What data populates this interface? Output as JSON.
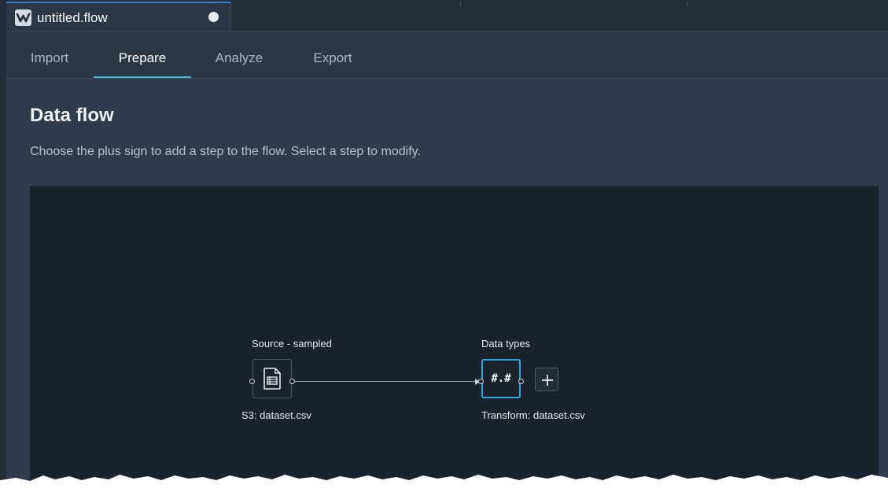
{
  "file_tab": {
    "title": "untitled.flow",
    "logo_icon": "data-wrangler-logo-icon",
    "unsaved_indicator": true
  },
  "subtabs": [
    {
      "label": "Import",
      "active": false
    },
    {
      "label": "Prepare",
      "active": true
    },
    {
      "label": "Analyze",
      "active": false
    },
    {
      "label": "Export",
      "active": false
    }
  ],
  "page": {
    "title": "Data flow",
    "description": "Choose the plus sign to add a step to the flow. Select a step to modify."
  },
  "flow": {
    "source": {
      "header": "Source - sampled",
      "caption": "S3: dataset.csv",
      "icon": "csv-file-icon"
    },
    "transform": {
      "header": "Data types",
      "caption": "Transform: dataset.csv",
      "symbol": "#.#"
    },
    "add_step_icon": "plus-icon"
  },
  "colors": {
    "accent": "#44b9d6",
    "selected_border": "#2ea9e0",
    "canvas": "#1a222c",
    "panel": "#2f3b4c"
  }
}
